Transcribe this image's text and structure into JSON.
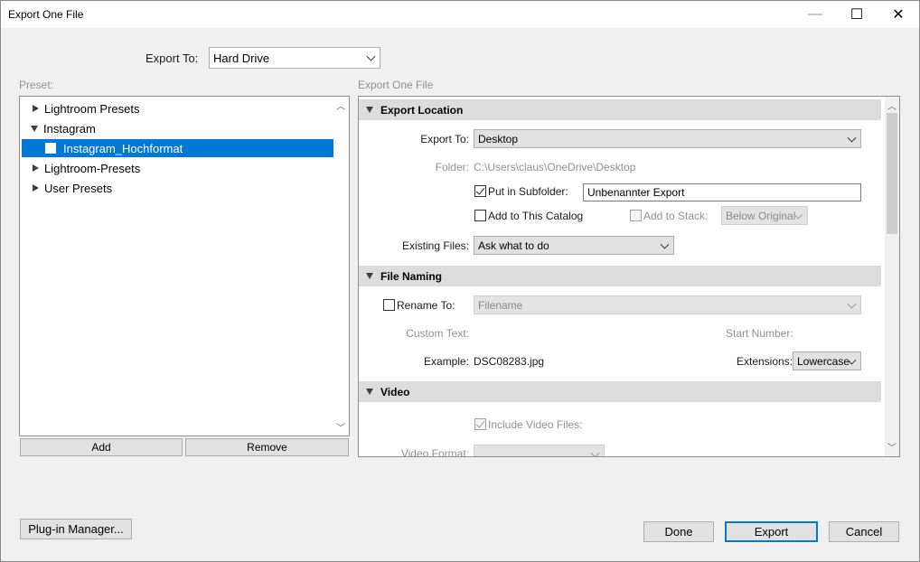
{
  "window": {
    "title": "Export One File",
    "minimize": "—",
    "maximize": "☐",
    "close": "✕"
  },
  "top": {
    "export_to_label": "Export To:",
    "export_to_value": "Hard Drive"
  },
  "preset": {
    "label": "Preset:",
    "items": [
      {
        "label": "Lightroom Presets",
        "expanded": false
      },
      {
        "label": "Instagram",
        "expanded": true
      },
      {
        "label": "Instagram_Hochformat",
        "selected": true
      },
      {
        "label": "Lightroom-Presets",
        "expanded": false
      },
      {
        "label": "User Presets",
        "expanded": false
      }
    ],
    "add": "Add",
    "remove": "Remove"
  },
  "settings": {
    "header": "Export One File",
    "export_location": {
      "title": "Export Location",
      "export_to_label": "Export To:",
      "export_to_value": "Desktop",
      "folder_label": "Folder:",
      "folder_value": "C:\\Users\\claus\\OneDrive\\Desktop",
      "subfolder_label": "Put in Subfolder:",
      "subfolder_checked": true,
      "subfolder_value": "Unbenannter Export",
      "add_catalog_label": "Add to This Catalog",
      "add_stack_label": "Add to Stack:",
      "stack_value": "Below Original",
      "existing_files_label": "Existing Files:",
      "existing_files_value": "Ask what to do"
    },
    "file_naming": {
      "title": "File Naming",
      "rename_label": "Rename To:",
      "rename_value": "Filename",
      "custom_text_label": "Custom Text:",
      "start_number_label": "Start Number:",
      "example_label": "Example:",
      "example_value": "DSC08283.jpg",
      "extensions_label": "Extensions:",
      "extensions_value": "Lowercase"
    },
    "video": {
      "title": "Video",
      "include_label": "Include Video Files:",
      "format_label": "Video Format:"
    }
  },
  "bottom": {
    "plugin_manager": "Plug-in Manager...",
    "done": "Done",
    "export": "Export",
    "cancel": "Cancel"
  }
}
